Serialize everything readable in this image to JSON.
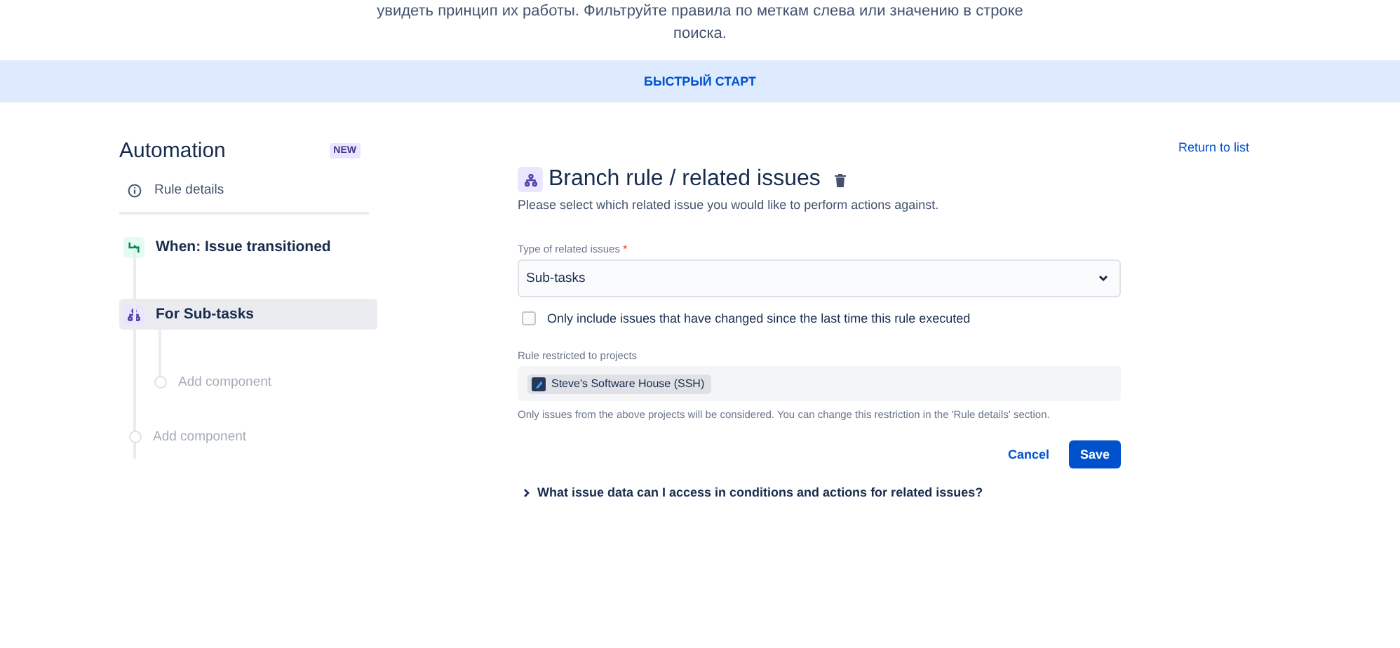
{
  "intro": {
    "lines": [
      "увидеть принцип их работы. Фильтруйте правила по меткам слева или значению в строке",
      "поиска."
    ]
  },
  "banner": {
    "label": "БЫСТРЫЙ СТАРТ"
  },
  "sidebar": {
    "title": "Automation",
    "badge": "NEW",
    "details": {
      "label": "Rule details"
    },
    "items": [
      {
        "kind": "trigger",
        "label": "When: Issue transitioned",
        "selected": false
      },
      {
        "kind": "branch",
        "label": "For Sub-tasks",
        "selected": true,
        "children": [
          {
            "kind": "add",
            "label": "Add component"
          }
        ]
      },
      {
        "kind": "add",
        "label": "Add component"
      }
    ]
  },
  "return_link": "Return to list",
  "panel": {
    "title": "Branch rule / related issues",
    "description": "Please select which related issue you would like to perform actions against.",
    "type_field": {
      "label": "Type of related issues",
      "required_mark": "*",
      "value": "Sub-tasks"
    },
    "checkbox": {
      "label": "Only include issues that have changed since the last time this rule executed",
      "checked": false
    },
    "projects": {
      "label": "Rule restricted to projects",
      "tags": [
        "Steve's Software House (SSH)"
      ],
      "help": "Only issues from the above projects will be considered. You can change this restriction in the 'Rule details' section."
    },
    "buttons": [
      {
        "kind": "subtle",
        "label": "Cancel"
      },
      {
        "kind": "primary",
        "label": "Save"
      }
    ],
    "disclosure": {
      "label": "What issue data can I access in conditions and actions for related issues?",
      "expanded": false
    }
  }
}
